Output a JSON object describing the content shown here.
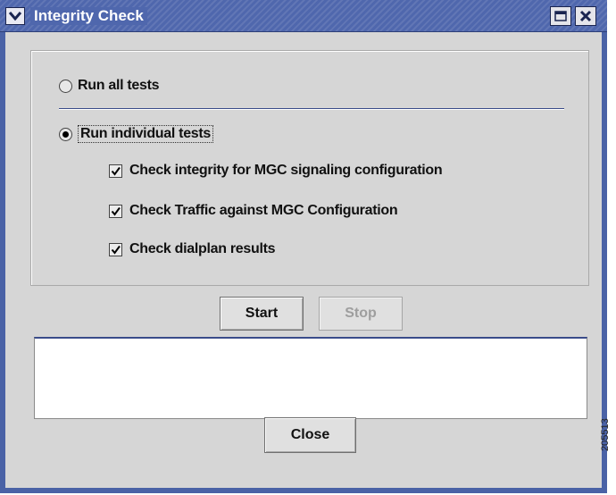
{
  "window": {
    "title": "Integrity Check",
    "accent_color": "#4f67ad",
    "menu_icon": "chevron-down-icon",
    "restore_icon": "restore-icon",
    "close_icon": "close-icon"
  },
  "options": {
    "run_all_label": "Run all tests",
    "run_all_selected": false,
    "run_individual_label": "Run individual tests",
    "run_individual_selected": true,
    "checks": [
      {
        "label": "Check integrity for MGC signaling configuration",
        "checked": true
      },
      {
        "label": "Check Traffic against MGC Configuration",
        "checked": true
      },
      {
        "label": "Check dialplan results",
        "checked": true
      }
    ]
  },
  "actions": {
    "start_label": "Start",
    "stop_label": "Stop",
    "stop_enabled": false,
    "close_label": "Close"
  },
  "output": {
    "text": ""
  },
  "figure_id": "205513"
}
